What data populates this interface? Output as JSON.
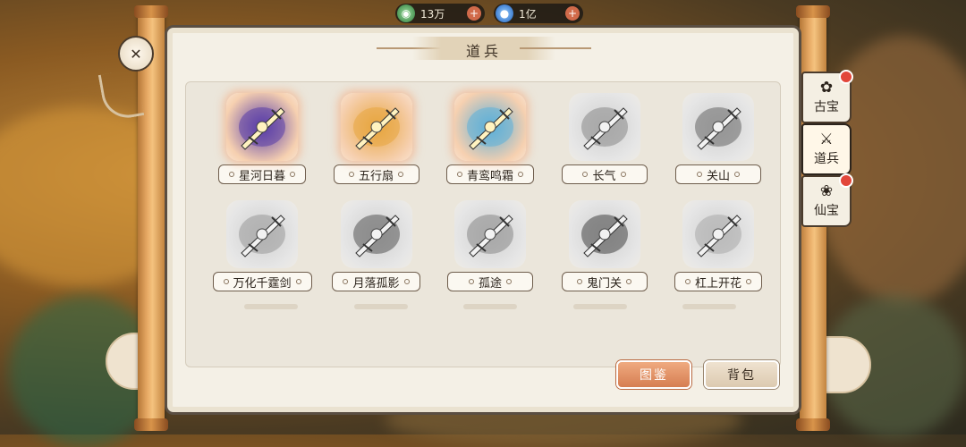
{
  "currency": [
    {
      "icon": "jade-coin-icon",
      "value": "13万"
    },
    {
      "icon": "water-drop-icon",
      "value": "1亿"
    }
  ],
  "panel": {
    "title": "道兵"
  },
  "items": [
    {
      "name": "星河日暮",
      "owned": true,
      "hue": "#5a3ea8"
    },
    {
      "name": "五行扇",
      "owned": true,
      "hue": "#e8a640"
    },
    {
      "name": "青鸾鸣霜",
      "owned": true,
      "hue": "#5fb0d8"
    },
    {
      "name": "长气",
      "owned": false,
      "hue": "#888"
    },
    {
      "name": "关山",
      "owned": false,
      "hue": "#666"
    },
    {
      "name": "万化千霆剑",
      "owned": false,
      "hue": "#999"
    },
    {
      "name": "月落孤影",
      "owned": false,
      "hue": "#555"
    },
    {
      "name": "孤途",
      "owned": false,
      "hue": "#888"
    },
    {
      "name": "鬼门关",
      "owned": false,
      "hue": "#444"
    },
    {
      "name": "杠上开花",
      "owned": false,
      "hue": "#aaa"
    }
  ],
  "buttons": {
    "codex": "图鉴",
    "bag": "背包"
  },
  "tabs": [
    {
      "label": "古宝",
      "icon": "ancient-treasure-icon",
      "badge": true
    },
    {
      "label": "道兵",
      "icon": "sword-soldier-icon",
      "badge": false,
      "active": true
    },
    {
      "label": "仙宝",
      "icon": "immortal-treasure-icon",
      "badge": true
    }
  ],
  "colors": {
    "accent": "#d67e52",
    "paper": "#f4f0e6",
    "badge": "#e2463a"
  }
}
